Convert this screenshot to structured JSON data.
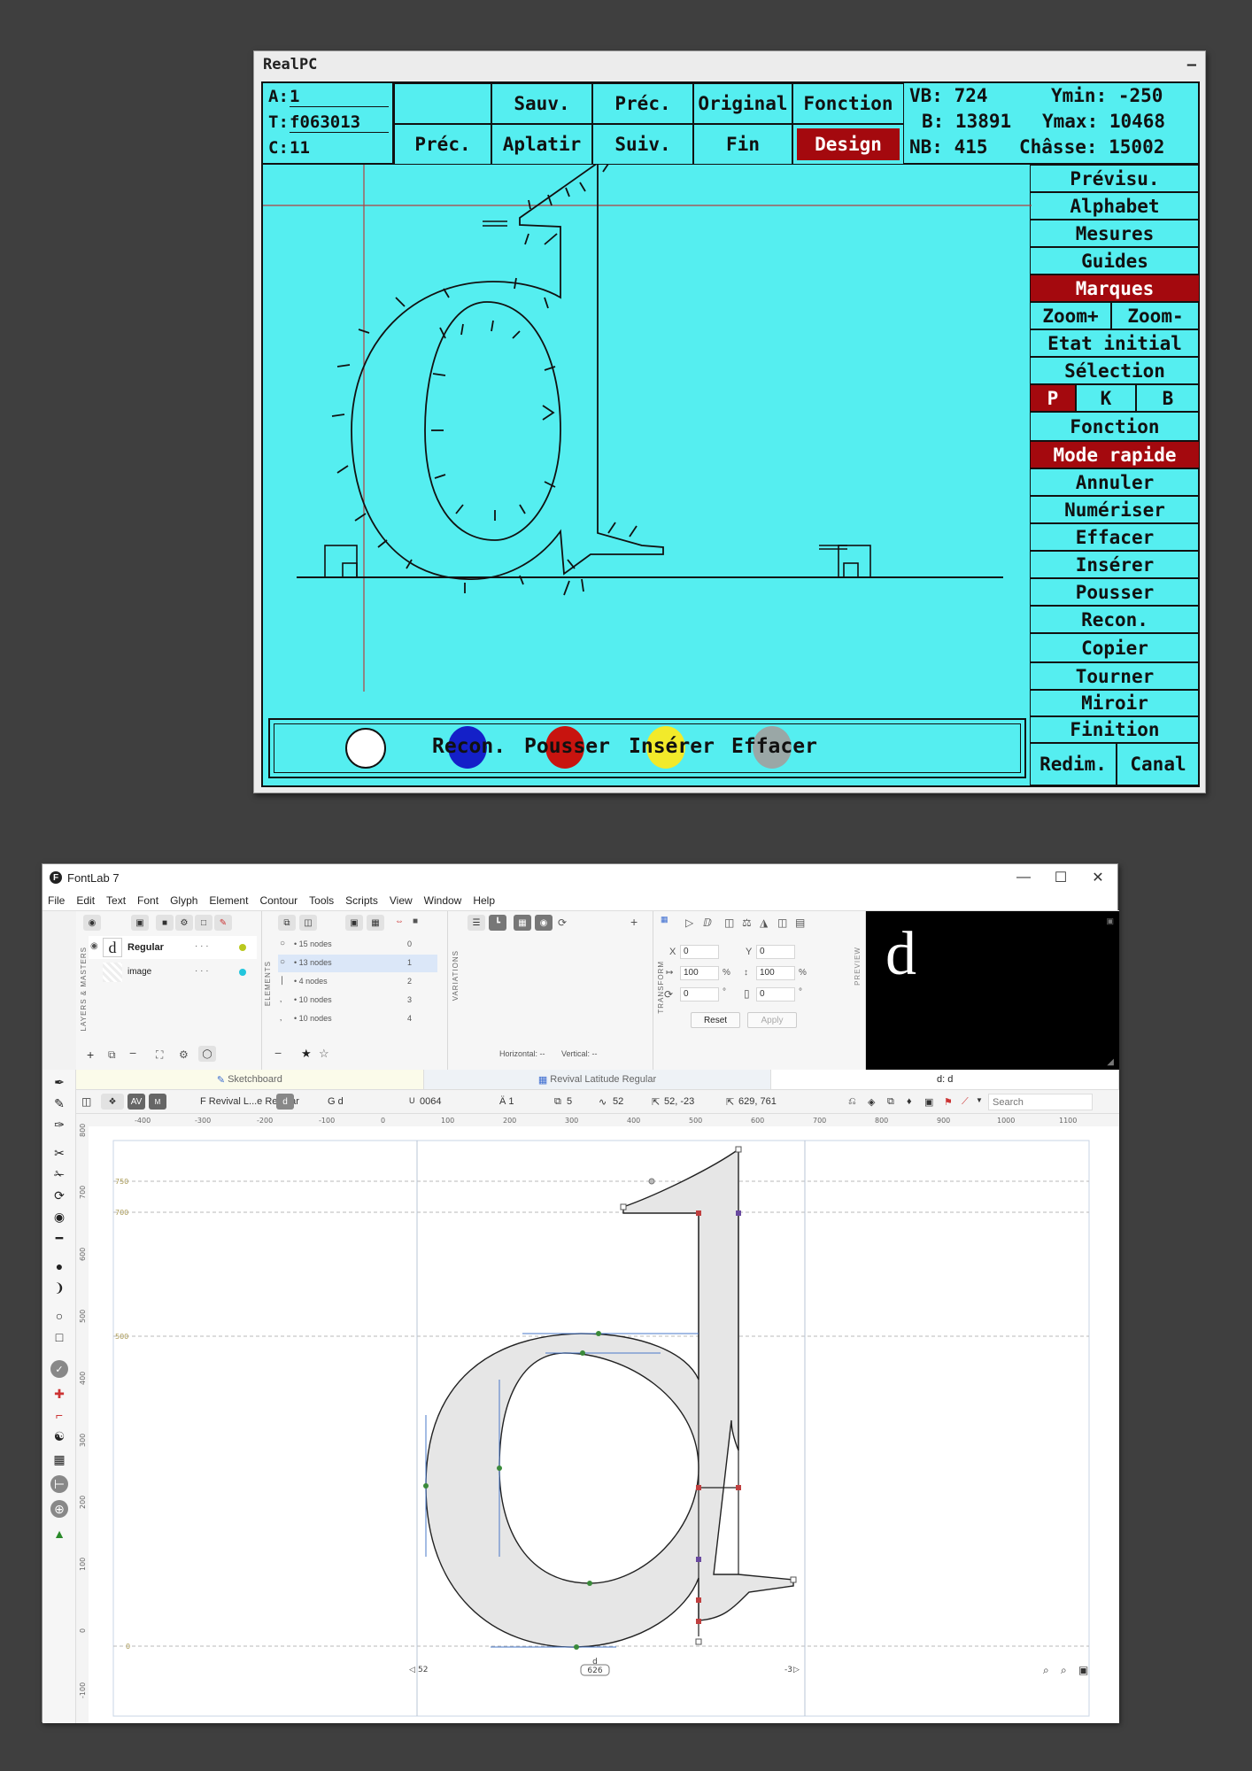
{
  "realpc": {
    "title": "RealPC",
    "minimize": "—",
    "fields": {
      "a_label": "A:",
      "a_value": "1",
      "t_label": "T:",
      "t_value": "f063013",
      "c_label": "C:",
      "c_value": "11"
    },
    "top_buttons": {
      "prec_left": "Préc.",
      "sauv": "Sauv.",
      "aplatir": "Aplatir",
      "prec": "Préc.",
      "suiv": "Suiv.",
      "original": "Original",
      "fin": "Fin",
      "fonction": "Fonction",
      "design": "Design"
    },
    "info": {
      "vb": "VB: 724",
      "ymin": "Ymin: -250",
      "b": "B: 13891",
      "ymax": "Ymax: 10468",
      "nb": "NB: 415",
      "chasse": "Châsse: 15002"
    },
    "side_menu": {
      "previsu": "Prévisu.",
      "alphabet": "Alphabet",
      "mesures": "Mesures",
      "guides": "Guides",
      "marques": "Marques",
      "zoom_plus": "Zoom+",
      "zoom_minus": "Zoom-",
      "etat_initial": "Etat initial",
      "selection": "Sélection",
      "p": "P",
      "k": "K",
      "b": "B",
      "fonction": "Fonction",
      "mode_rapide": "Mode rapide",
      "annuler": "Annuler",
      "numeriser": "Numériser",
      "effacer": "Effacer",
      "inserer": "Insérer",
      "pousser": "Pousser",
      "recon": "Recon.",
      "copier": "Copier",
      "tourner": "Tourner",
      "miroir": "Miroir",
      "finition": "Finition",
      "redim": "Redim.",
      "canal": "Canal"
    },
    "bottom_tools": {
      "recon": "Recon.",
      "pousser": "Pousser",
      "inserer": "Insérer",
      "effacer": "Effacer"
    },
    "colors": {
      "screen": "#55eef0",
      "active": "#a4090e",
      "recon": "#1420c8",
      "pousser": "#c8140f",
      "inserer": "#f2ea2a",
      "effacer": "#9aa7a6"
    }
  },
  "fontlab": {
    "title": "FontLab 7",
    "menu": [
      "File",
      "Edit",
      "Text",
      "Font",
      "Glyph",
      "Element",
      "Contour",
      "Tools",
      "Scripts",
      "View",
      "Window",
      "Help"
    ],
    "layers": {
      "panel_label": "LAYERS & MASTERS",
      "items": [
        {
          "glyph": "d",
          "name": "Regular",
          "dots": "· · ·",
          "color": "#b9c81e"
        },
        {
          "glyph": "",
          "name": "image",
          "dots": "· · ·",
          "color": "#22c6dd"
        }
      ]
    },
    "elements": {
      "panel_label": "ELEMENTS",
      "rows": [
        {
          "label": "• 15 nodes",
          "index": "0"
        },
        {
          "label": "• 13 nodes",
          "index": "1"
        },
        {
          "label": "• 4 nodes",
          "index": "2"
        },
        {
          "label": "• 10 nodes",
          "index": "3"
        },
        {
          "label": "• 10 nodes",
          "index": "4"
        }
      ]
    },
    "variations": {
      "panel_label": "VARIATIONS",
      "horizontal": "Horizontal: --",
      "vertical": "Vertical: --"
    },
    "transform": {
      "panel_label": "TRANSFORM",
      "x_label": "X",
      "x_value": "0",
      "y_label": "Y",
      "y_value": "0",
      "w_value": "100",
      "h_value": "100",
      "pct": "%",
      "rot_value": "0",
      "slant_value": "0",
      "deg": "°",
      "reset": "Reset",
      "apply": "Apply"
    },
    "preview": {
      "panel_label": "PREVIEW",
      "glyph": "d"
    },
    "tabs": [
      "Sketchboard",
      "Revival Latitude Regular",
      "d: d"
    ],
    "glyphbar": {
      "font_name": "F Revival L...e Regular",
      "glyph_box": "d",
      "glyph_name": "G d",
      "unicode": "U\u0000 0064",
      "unicode_label": "U",
      "unicode_value": "0064",
      "a_count": "Ä 1",
      "contours": "5",
      "nodes": "52",
      "coords": "52, -23",
      "size": "629, 761",
      "search_placeholder": "Search"
    },
    "ruler": {
      "h_ticks": [
        "-400",
        "-300",
        "-200",
        "-100",
        "0",
        "100",
        "200",
        "300",
        "400",
        "500",
        "600",
        "700",
        "800",
        "900",
        "1000",
        "1100"
      ],
      "v_ticks": [
        "800",
        "700",
        "600",
        "500",
        "400",
        "300",
        "200",
        "100",
        "0",
        "-100"
      ]
    },
    "metric_labels": [
      "750",
      "700",
      "500",
      "0"
    ],
    "bottom_metrics": {
      "lsb": "52",
      "glyph": "d",
      "width": "626",
      "rsb": "-3"
    },
    "colors": {
      "node": "#3a8a3a",
      "handle": "#4a78c8",
      "corner": "#c04040",
      "fill": "#e8e8e8"
    }
  }
}
